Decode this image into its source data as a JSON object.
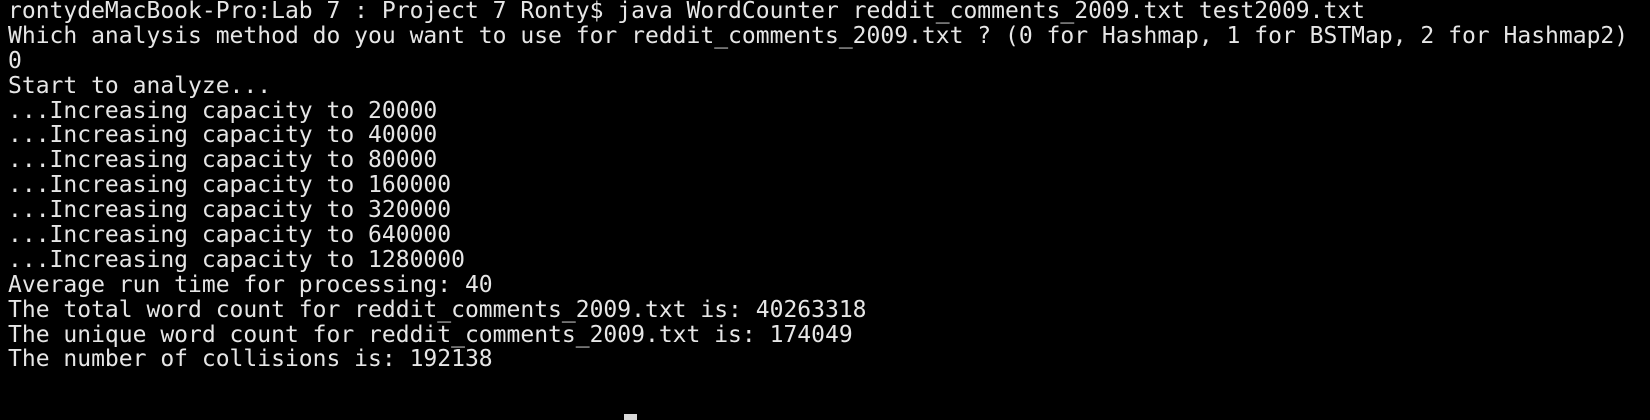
{
  "terminal": {
    "lines": [
      "rontydeMacBook-Pro:Lab 7 : Project 7 Ronty$ java WordCounter reddit_comments_2009.txt test2009.txt",
      "Which analysis method do you want to use for reddit_comments_2009.txt ? (0 for Hashmap, 1 for BSTMap, 2 for Hashmap2)",
      "0",
      "Start to analyze...",
      "...Increasing capacity to 20000",
      "...Increasing capacity to 40000",
      "...Increasing capacity to 80000",
      "...Increasing capacity to 160000",
      "...Increasing capacity to 320000",
      "...Increasing capacity to 640000",
      "...Increasing capacity to 1280000",
      "Average run time for processing: 40",
      "The total word count for reddit_comments_2009.txt is: 40263318",
      "The unique word count for reddit_comments_2009.txt is: 174049",
      "The number of collisions is: 192138"
    ]
  },
  "colors": {
    "background": "#000000",
    "text": "#e6e6e6",
    "cursor": "#d9d9d9"
  }
}
